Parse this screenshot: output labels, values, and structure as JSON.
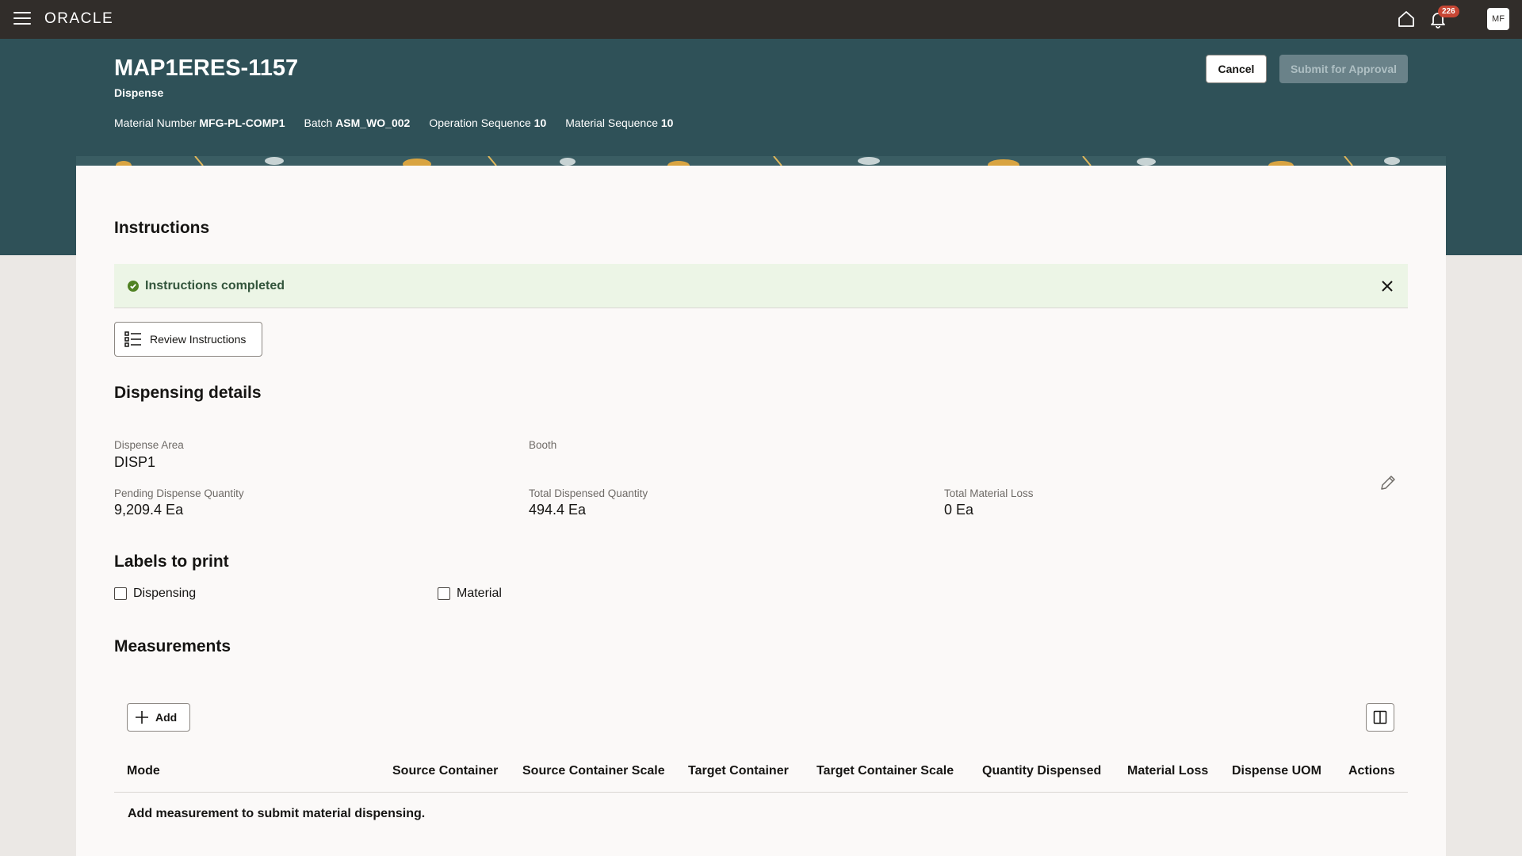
{
  "topbar": {
    "logo": "ORACLE",
    "notifications_count": "226",
    "avatar_initials": "MF"
  },
  "header": {
    "title": "MAP1ERES-1157",
    "subtitle": "Dispense",
    "meta": [
      {
        "label": "Material Number",
        "value": "MFG-PL-COMP1"
      },
      {
        "label": "Batch",
        "value": "ASM_WO_002"
      },
      {
        "label": "Operation Sequence",
        "value": "10"
      },
      {
        "label": "Material Sequence",
        "value": "10"
      }
    ],
    "cancel_label": "Cancel",
    "submit_label": "Submit for Approval"
  },
  "instructions": {
    "heading": "Instructions",
    "banner_text": "Instructions completed",
    "review_label": "Review Instructions"
  },
  "dispensing": {
    "heading": "Dispensing details",
    "dispense_area_label": "Dispense Area",
    "dispense_area_value": "DISP1",
    "booth_label": "Booth",
    "pending_label": "Pending Dispense Quantity",
    "pending_value": "9,209.4 Ea",
    "total_dispensed_label": "Total Dispensed Quantity",
    "total_dispensed_value": "494.4 Ea",
    "material_loss_label": "Total Material Loss",
    "material_loss_value": "0 Ea"
  },
  "labels": {
    "heading": "Labels to print",
    "dispensing_label": "Dispensing",
    "material_label": "Material"
  },
  "measurements": {
    "heading": "Measurements",
    "add_label": "Add",
    "columns": [
      "Mode",
      "Source Container",
      "Source Container Scale",
      "Target Container",
      "Target Container Scale",
      "Quantity Dispensed",
      "Material Loss",
      "Dispense UOM",
      "Actions"
    ],
    "empty_message": "Add measurement to submit material dispensing."
  },
  "colors": {
    "topbar": "#312d2a",
    "header_band": "#2f5158",
    "success_bg": "#ecf5e6",
    "success_icon": "#508223",
    "badge": "#c74634"
  }
}
